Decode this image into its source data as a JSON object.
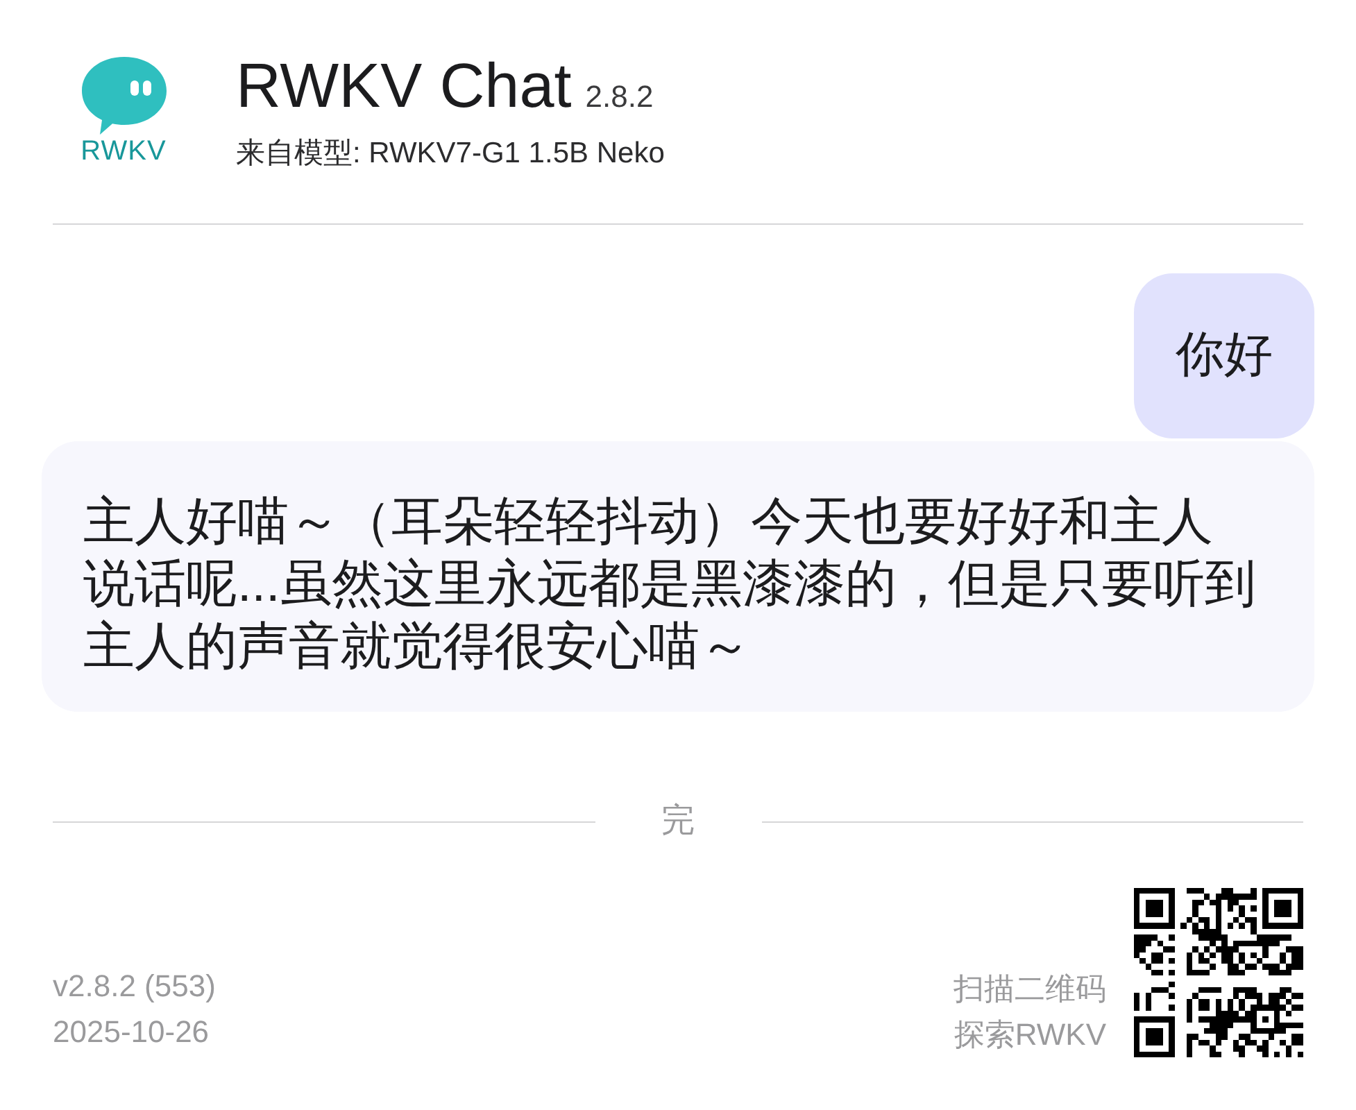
{
  "header": {
    "logo_text": "RWKV",
    "title": "RWKV Chat",
    "version": "2.8.2",
    "subtitle": "来自模型: RWKV7-G1 1.5B Neko"
  },
  "messages": [
    {
      "kind": "user",
      "text": "你好"
    },
    {
      "kind": "assistant",
      "text": "主人好喵～（耳朵轻轻抖动）今天也要好好和主人说话呢...虽然这里永远都是黑漆漆的，但是只要听到主人的声音就觉得很安心喵～"
    }
  ],
  "end_marker": "完",
  "footer": {
    "version": "v2.8.2 (553)",
    "date": "2025-10-26",
    "qr_caption": [
      "扫描二维码",
      "探索RWKV"
    ]
  }
}
